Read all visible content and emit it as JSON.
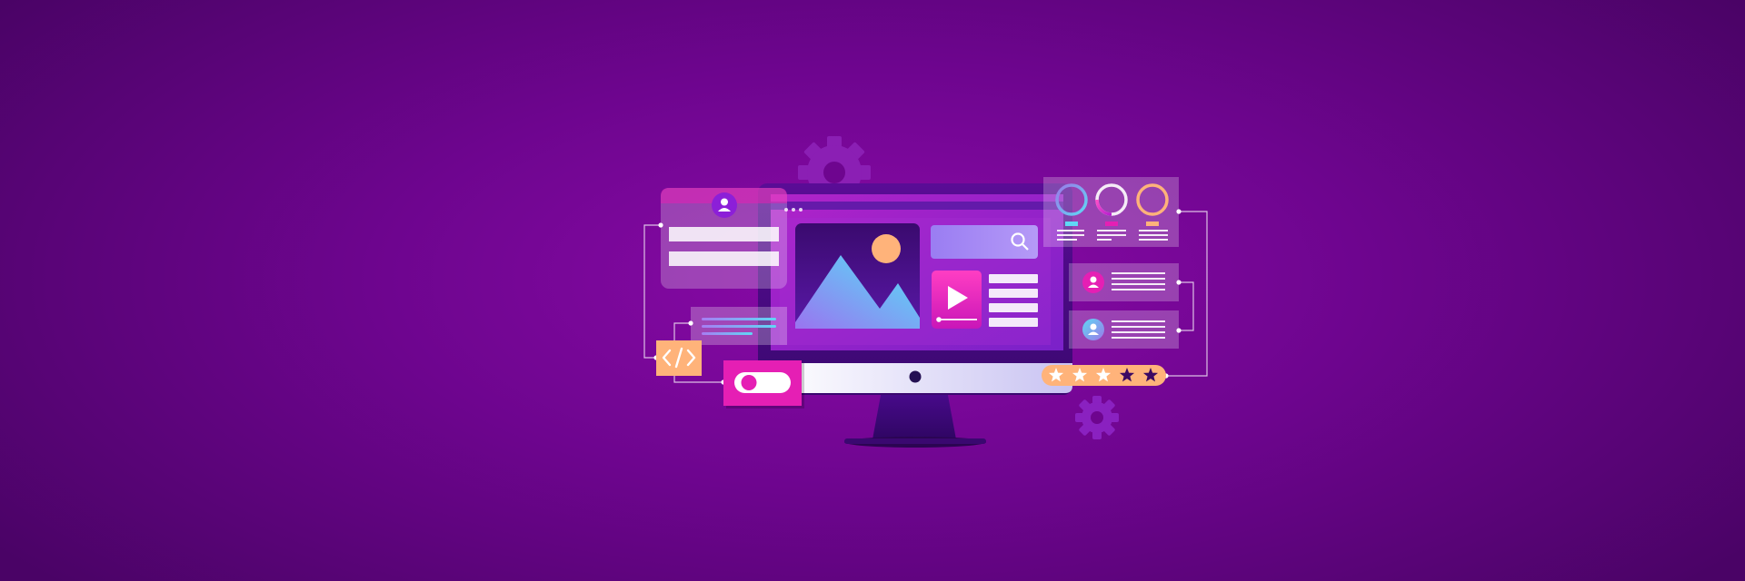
{
  "palette": {
    "background": "#6e058f",
    "magenta": "#e51fb4",
    "orange": "#ffb37a",
    "cyan": "#5fd8f5",
    "violet": "#9b79e8",
    "deep_purple": "#3b0a63"
  },
  "illustration": {
    "scene": "web development",
    "rating": {
      "filled_stars": 3,
      "total_stars": 5
    },
    "toggle": {
      "state": "off"
    },
    "progress_rings": 3,
    "profile_rows": 2,
    "code_badge_glyph": "</>"
  }
}
